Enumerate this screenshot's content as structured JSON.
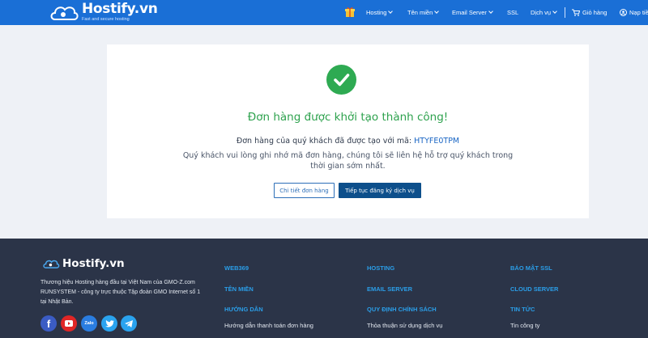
{
  "header": {
    "brand": "Hostify.vn",
    "tagline": "Fast and secure hosting",
    "nav": {
      "hosting": "Hosting",
      "domain": "Tên miền",
      "email_server": "Email Server",
      "ssl": "SSL",
      "services": "Dịch vụ",
      "cart": "Giỏ hàng",
      "topup": "Nạp tiề"
    }
  },
  "confirmation": {
    "title": "Đơn hàng được khởi tạo thành công!",
    "order_prefix": "Đơn hàng của quý khách đã được tạo với mã:",
    "order_code": "HTYFE0TPM",
    "notice": "Quý khách vui lòng ghi nhớ mã đơn hàng, chúng tôi sẽ liên hệ hỗ trợ quý khách trong thời gian sớm nhất.",
    "details_button": "Chi tiết đơn hàng",
    "continue_button": "Tiếp tục đăng ký dịch vụ"
  },
  "footer": {
    "brand": "Hostify.vn",
    "description": "Thương hiệu Hosting hàng đầu tại Việt Nam của GMO-Z.com RUNSYSTEM - công ty trực thuộc Tập đoàn GMO Internet số 1 tại Nhật Bản.",
    "col1": {
      "a": "WEB369",
      "b": "TÊN MIỀN",
      "c": "HƯỚNG DẪN",
      "d": "Hướng dẫn thanh toán đơn hàng"
    },
    "col2": {
      "a": "HOSTING",
      "b": "EMAIL SERVER",
      "c": "QUY ĐỊNH CHÍNH SÁCH",
      "d": "Thỏa thuận sử dụng dịch vụ"
    },
    "col3": {
      "a": "BẢO MẬT SSL",
      "b": "CLOUD SERVER",
      "c": "TIN TỨC",
      "d": "Tin công ty"
    },
    "social": [
      "facebook-icon",
      "youtube-icon",
      "zalo-icon",
      "twitter-icon",
      "telegram-icon"
    ],
    "social_zalo_text": "Zalo"
  },
  "colors": {
    "header_blue": "#1a6fd6",
    "success_green": "#2eaa52",
    "footer_bg": "#2b3448",
    "footer_link": "#2b9ee8",
    "primary_button": "#0d4f8b"
  }
}
